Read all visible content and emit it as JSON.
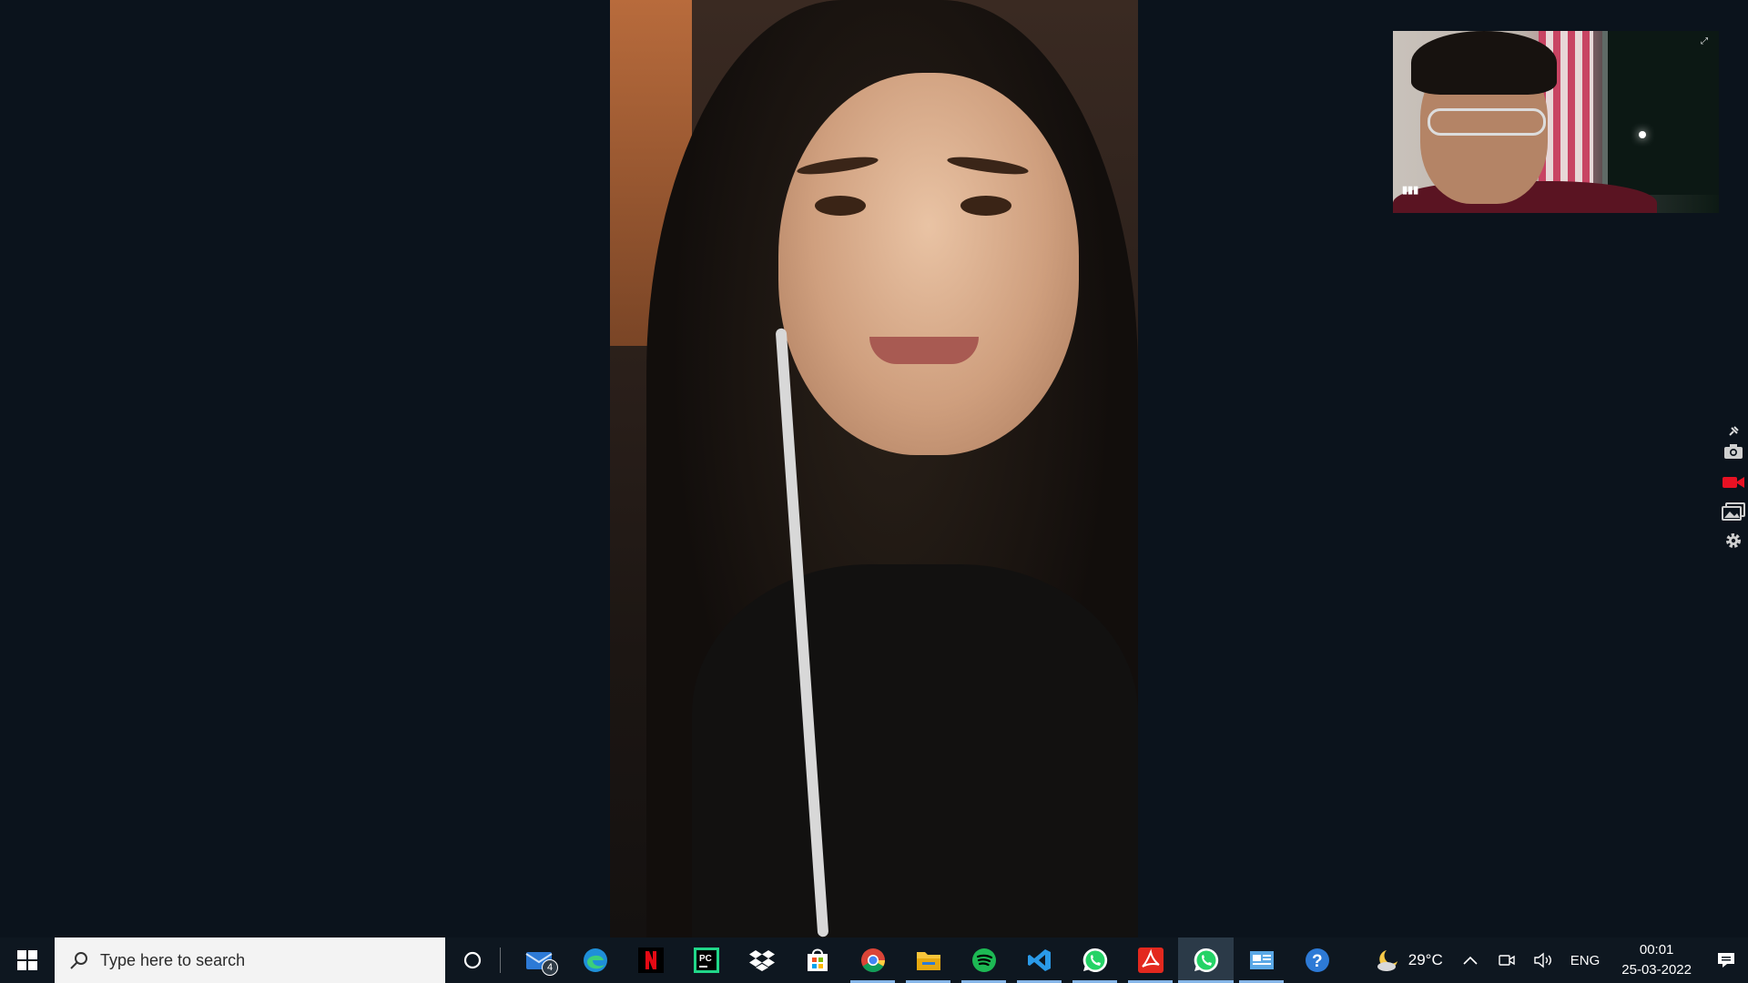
{
  "taskbar": {
    "search_placeholder": "Type here to search",
    "mail_badge": "4",
    "apps": [
      "Mail",
      "Microsoft Edge",
      "Netflix",
      "PyCharm",
      "Dropbox",
      "Microsoft Store",
      "Google Chrome",
      "File Explorer",
      "Spotify",
      "Visual Studio Code",
      "WhatsApp",
      "Adobe Acrobat",
      "WhatsApp",
      "Control Panel",
      "Get Help"
    ],
    "weather": {
      "icon": "moon-cloud-icon",
      "temperature": "29°C"
    },
    "language": "ENG",
    "clock": {
      "time": "00:01",
      "date": "25-03-2022"
    }
  },
  "colors": {
    "background": "#0b131c",
    "taskbar": "#0e1720",
    "running_indicator": "#86b6e8",
    "record_red": "#e81123"
  }
}
